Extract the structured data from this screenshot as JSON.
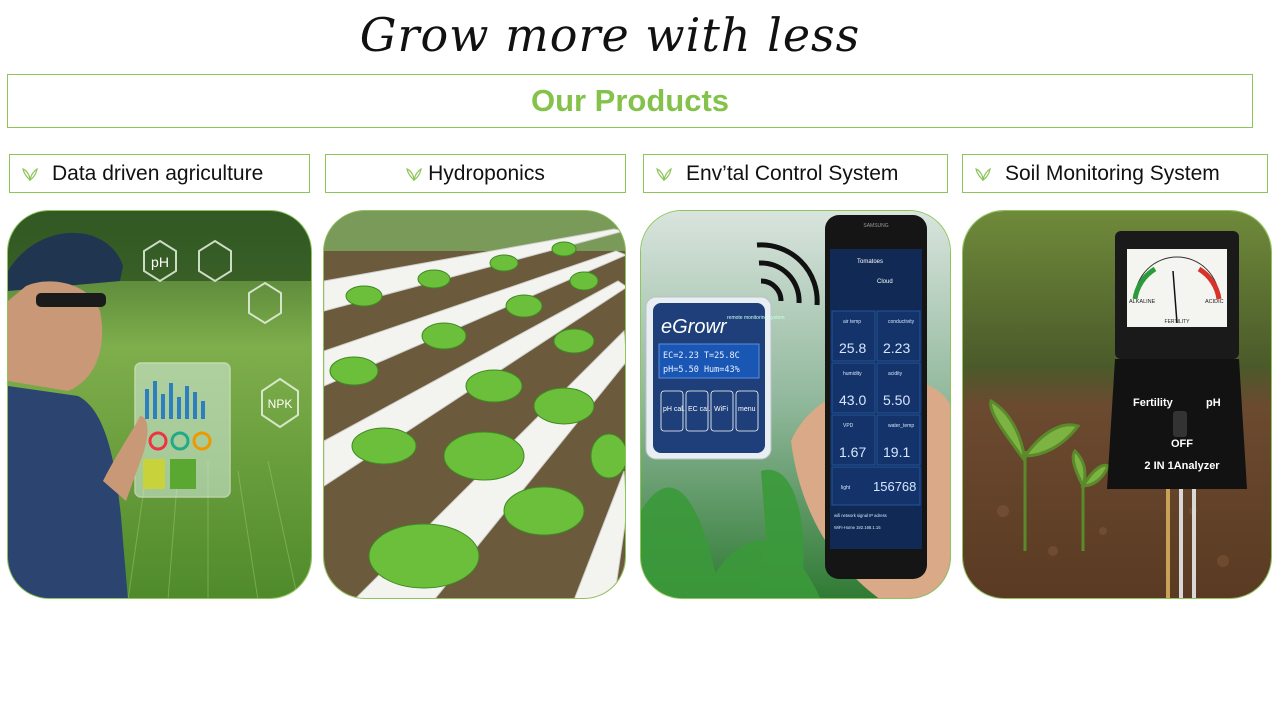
{
  "slide": {
    "title": "Grow more with less",
    "banner": "Our Products"
  },
  "products": [
    {
      "label": "Data driven agriculture",
      "image_icon": "farmer-tablet-image"
    },
    {
      "label": "Hydroponics",
      "image_icon": "hydroponic-lettuce-image"
    },
    {
      "label": "Env’tal Control System",
      "image_icon": "monitoring-device-phone-image"
    },
    {
      "label": "Soil Monitoring System",
      "image_icon": "soil-analyzer-image"
    }
  ],
  "card1": {
    "badge_ph": "pH",
    "badge_npk": "NPK"
  },
  "card3": {
    "brand": "eGrowr",
    "brand_sub": "remote monitoring system",
    "readout_1": "EC=2.23  T=25.8C",
    "readout_2": "pH=5.50  Hum=43%",
    "btn_ph": "pH cal.",
    "btn_ec": "EC cal.",
    "btn_wifi": "WiFi",
    "btn_menu": "menu",
    "phone_brand": "SAMSUNG",
    "app_header": "Tomatoes",
    "cloud_label": "Cloud",
    "tiles": [
      {
        "name": "air temp",
        "value": "25.8"
      },
      {
        "name": "conductivity",
        "value": "2.23"
      },
      {
        "name": "humidity",
        "value": "43.0"
      },
      {
        "name": "acidity",
        "value": "5.50"
      },
      {
        "name": "VPD",
        "value": "1.67"
      },
      {
        "name": "water_temp",
        "value": "19.1"
      },
      {
        "name": "light",
        "value": "156768"
      }
    ],
    "footer_1": "wifi network   signal   IP adress",
    "footer_2": "WiFi-Home         192.168.1.15"
  },
  "card4": {
    "gauge_left": "ALKALINE",
    "gauge_right": "ACIDIC",
    "gauge_mid": "FERTILITY",
    "label_fertility": "Fertility",
    "label_ph": "pH",
    "label_off": "OFF",
    "model": "2 IN 1Analyzer"
  },
  "colors": {
    "accent_green": "#84c24c",
    "border_green": "#8dc55a"
  }
}
